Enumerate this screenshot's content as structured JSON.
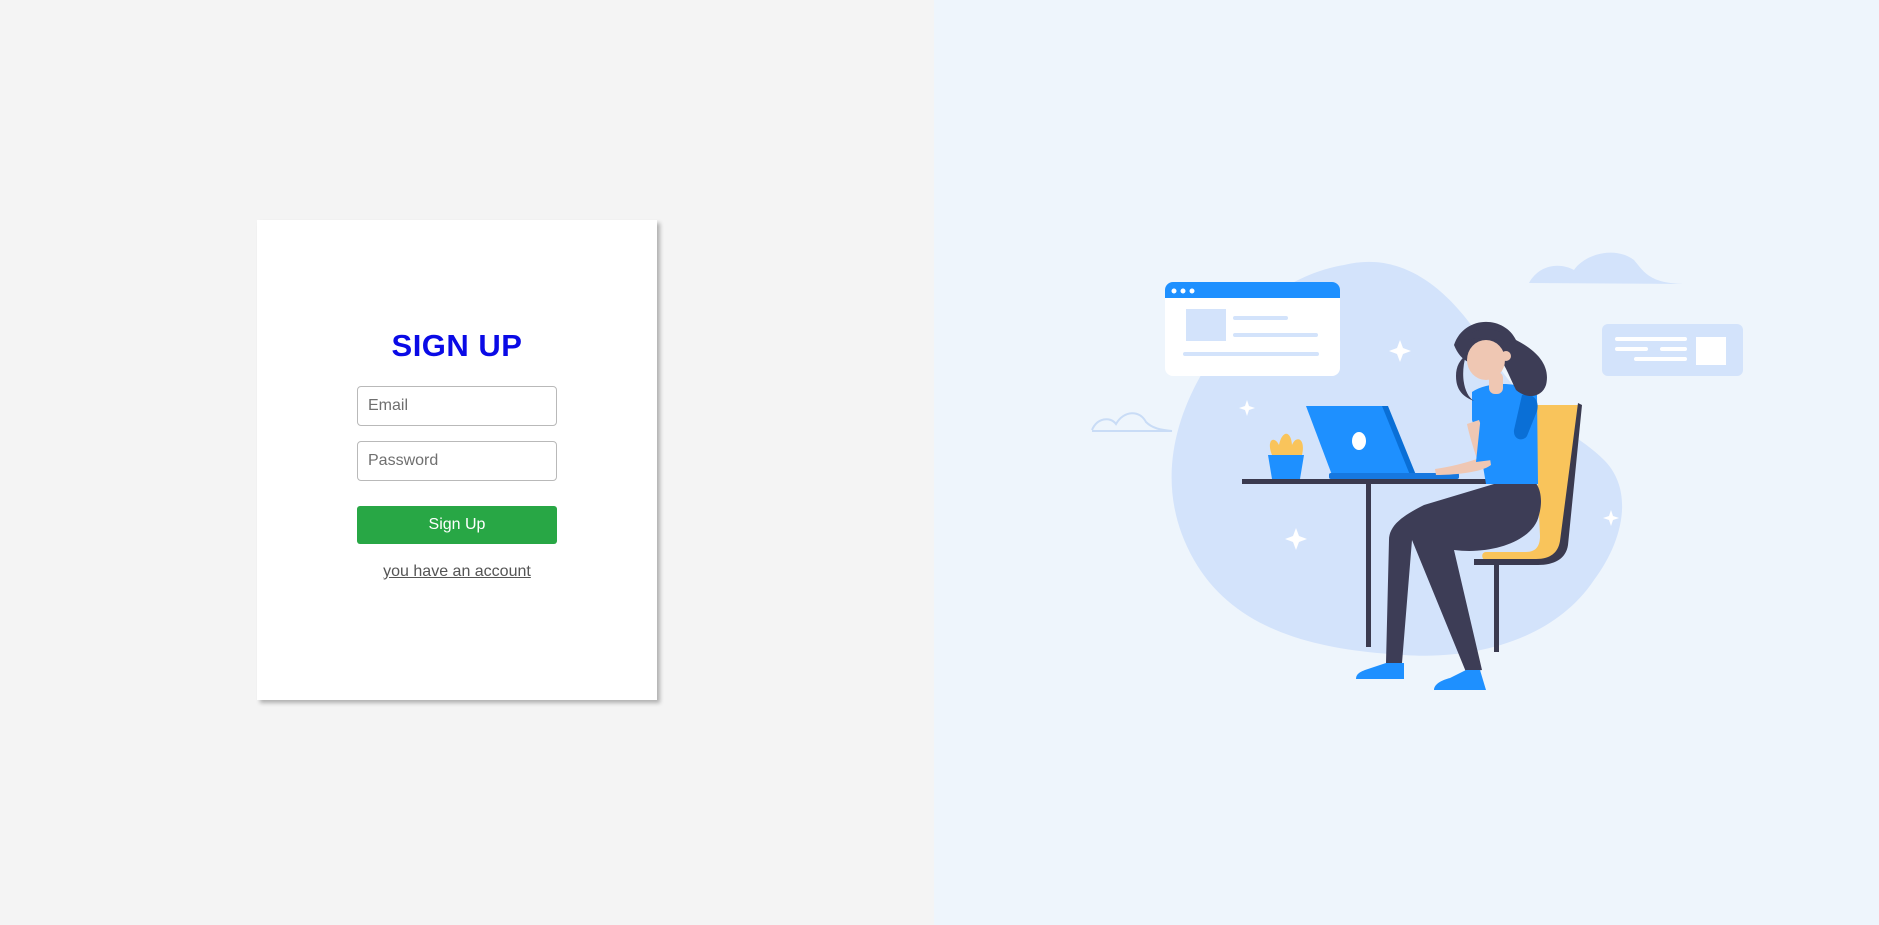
{
  "signup": {
    "title": "SIGN UP",
    "email_placeholder": "Email",
    "password_placeholder": "Password",
    "submit_label": "Sign Up",
    "login_link": "you have an account"
  },
  "colors": {
    "left_background": "#f4f4f4",
    "right_background": "#eef5fc",
    "title": "#0a0ae6",
    "button": "#28a745",
    "illustration_blue": "#1e90ff",
    "illustration_yellow": "#f9c45b"
  },
  "illustration": {
    "description_icon": "woman-working-on-laptop-illustration"
  }
}
